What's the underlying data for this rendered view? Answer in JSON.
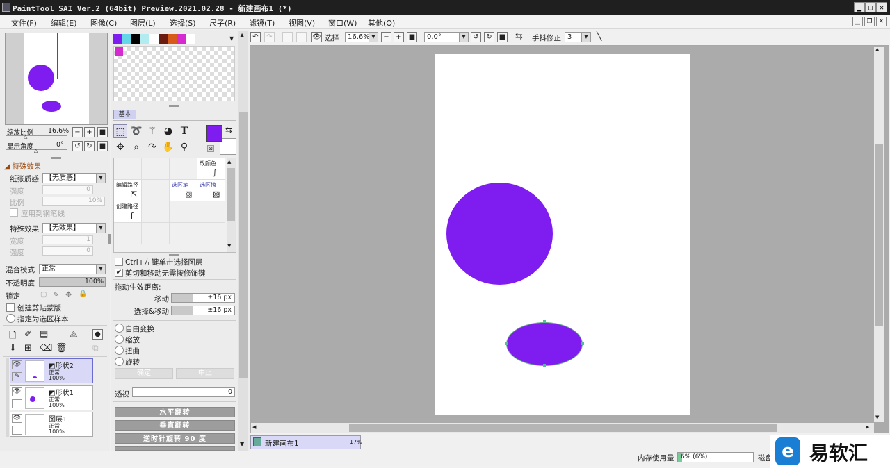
{
  "titlebar": {
    "title": "PaintTool SAI Ver.2 (64bit) Preview.2021.02.28 - 新建画布1 (*)"
  },
  "menu": [
    "文件(F)",
    "编辑(E)",
    "图像(C)",
    "图层(L)",
    "选择(S)",
    "尺子(R)",
    "滤镜(T)",
    "视图(V)",
    "窗口(W)",
    "其他(O)"
  ],
  "navigator": {
    "zoom_label": "缩放比例",
    "zoom_value": "16.6%",
    "angle_label": "显示角度",
    "angle_value": "0°"
  },
  "effects": {
    "section_title": "特殊效果",
    "paper_label": "纸张质感",
    "paper_value": "【无质感】",
    "strength_label": "强度",
    "strength_value": "0",
    "scale_label": "比例",
    "scale_value": "10%",
    "apply_pen_label": "应用到钢笔线",
    "effect_label": "特殊效果",
    "effect_value": "【无效果】",
    "width_label": "宽度",
    "width_value": "1",
    "effect_strength_label": "强度",
    "effect_strength_value": "0"
  },
  "layerprops": {
    "blend_label": "混合模式",
    "blend_value": "正常",
    "opacity_label": "不透明度",
    "opacity_value": "100%",
    "opacity_fraction": 1.0,
    "lock_label": "锁定",
    "clip_label": "创建剪贴蒙版",
    "selsrc_label": "指定为选区样本"
  },
  "layers": [
    {
      "name": "形状2",
      "mode": "正常",
      "opacity": "100%"
    },
    {
      "name": "形状1",
      "mode": "正常",
      "opacity": "100%"
    },
    {
      "name": "图层1",
      "mode": "正常",
      "opacity": "100%"
    }
  ],
  "palette": {
    "colors": [
      "#7f1cf0",
      "#63d6e8",
      "#000000",
      "#b2ecf0",
      "#ffffff",
      "#6b1a10",
      "#d75a1a",
      "#d42ad0",
      "#ffffff"
    ],
    "custom": [
      "#d42ad0"
    ]
  },
  "tools": {
    "tab": "基本",
    "foreground": "#7f1cf0",
    "background": "#ffffff"
  },
  "vector_tools": {
    "recolor": "改颜色",
    "edit_path": "编辑路径",
    "sel_a": "选区笔",
    "sel_b": "选区擦",
    "create_path": "创建路径"
  },
  "options": {
    "ctrl_click_label": "Ctrl+左键单击选择图层",
    "cut_move_label": "剪切和移动无需按修饰键",
    "drag_label": "拖动生效距离:",
    "move_label": "移动",
    "move_value": "±16 px",
    "selmove_label": "选择&移动",
    "selmove_value": "±16 px"
  },
  "transform": {
    "free": "自由变换",
    "scale": "缩放",
    "distort": "扭曲",
    "rotate": "旋转",
    "ok": "确定",
    "cancel": "中止",
    "perspective_label": "透视",
    "perspective_value": "0",
    "flip_h": "水平翻转",
    "flip_v": "垂直翻转",
    "rotate_ccw": "逆时针旋转 90 度"
  },
  "toolbar": {
    "select_label": "选择",
    "zoom": "16.6%",
    "angle": "0.0°",
    "stabilizer_label": "手抖修正",
    "stabilizer_value": "3"
  },
  "canvas_tab": {
    "name": "新建画布1",
    "zoom": "17%"
  },
  "status": {
    "memory_label": "内存使用量",
    "memory_value": "6% (6%)",
    "memory_fraction": 0.06,
    "disk_label": "磁盘"
  },
  "watermark": {
    "text": "易软汇",
    "color": "#1a7fd4"
  }
}
